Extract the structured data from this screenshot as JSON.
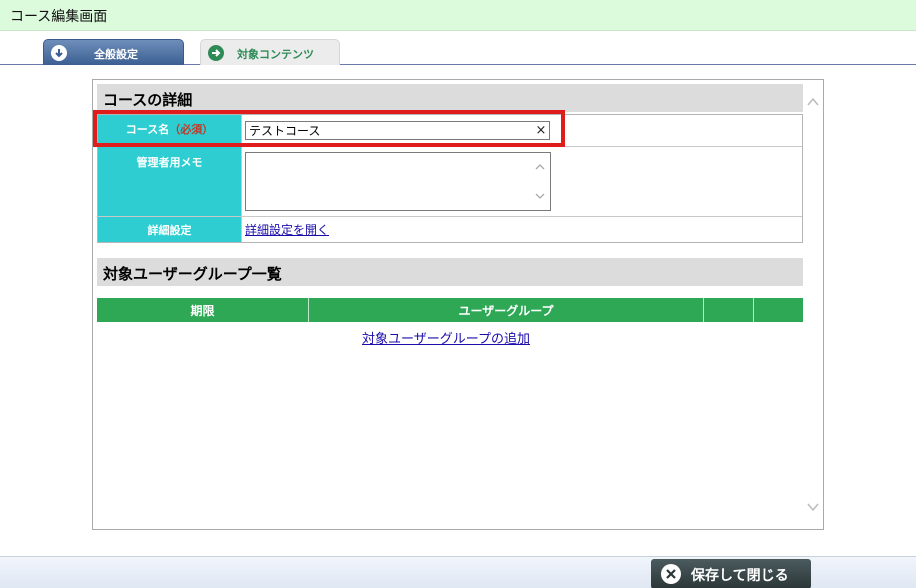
{
  "window": {
    "title": "コース編集画面"
  },
  "tabs": [
    {
      "label": "全般設定",
      "icon": "arrow-down-circle-icon",
      "active": true
    },
    {
      "label": "対象コンテンツ",
      "icon": "arrow-right-circle-icon",
      "active": false
    }
  ],
  "details": {
    "heading": "コースの詳細",
    "name_label": "コース名",
    "required_label": "（必須）",
    "name_value": "テストコース",
    "clear_symbol": "×",
    "memo_label": "管理者用メモ",
    "memo_value": "",
    "advanced_label": "詳細設定",
    "advanced_link": "詳細設定を開く"
  },
  "groups": {
    "heading": "対象ユーザーグループ一覧",
    "columns": [
      "期限",
      "ユーザーグループ",
      "",
      ""
    ],
    "add_link": "対象ユーザーグループの追加"
  },
  "footer": {
    "save_label": "保存して閉じる",
    "save_icon": "close-circle-icon"
  },
  "colors": {
    "title_bg": "#dcfadc",
    "label_cyan": "#2dcdd1",
    "table_green": "#2ea855",
    "highlight_red": "#e01d1d",
    "tab_active": "#3b5f92"
  }
}
